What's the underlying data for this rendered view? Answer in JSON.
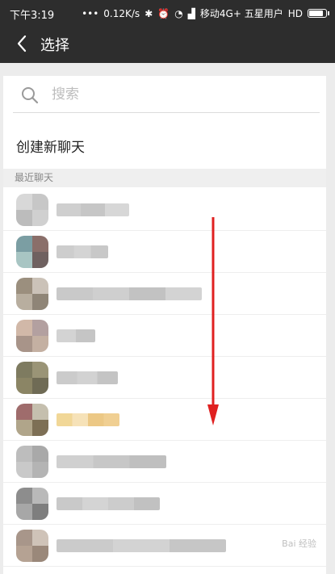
{
  "status_bar": {
    "time": "下午3:19",
    "network_speed": "0.12K/s",
    "carrier": "移动4G+ 五星用户",
    "network_type": "HD",
    "battery_level": 0.9
  },
  "app_bar": {
    "title": "选择"
  },
  "search": {
    "placeholder": "搜索",
    "value": ""
  },
  "new_chat": {
    "label": "创建新聊天"
  },
  "recent": {
    "header": "最近聊天",
    "items": [
      {
        "avatar_colors": [
          "#d8d8d8",
          "#c7c7c7",
          "#bcbcbc",
          "#d0d0d0"
        ],
        "name_colors": [
          "#cfcfcf",
          "#c6c6c6",
          "#d7d7d7"
        ],
        "name_width": 90
      },
      {
        "avatar_colors": [
          "#7b9ea3",
          "#8a6f6a",
          "#a8c5c3",
          "#6f6160"
        ],
        "name_colors": [
          "#cdcdcd",
          "#d4d4d4",
          "#c8c8c8"
        ],
        "name_width": 64
      },
      {
        "avatar_colors": [
          "#9b8f7e",
          "#cbc2b8",
          "#b8ae9f",
          "#8f8577"
        ],
        "name_colors": [
          "#c9c9c9",
          "#cfcfcf",
          "#c2c2c2",
          "#d3d3d3"
        ],
        "name_width": 180
      },
      {
        "avatar_colors": [
          "#d1b8a8",
          "#b3a0a0",
          "#a89489",
          "#c4b0a2"
        ],
        "name_colors": [
          "#d3d3d3",
          "#c5c5c5"
        ],
        "name_width": 48
      },
      {
        "avatar_colors": [
          "#7e7b60",
          "#9a9476",
          "#8b8565",
          "#6f6b55"
        ],
        "name_colors": [
          "#cbcbcb",
          "#d2d2d2",
          "#c4c4c4"
        ],
        "name_width": 76
      },
      {
        "avatar_colors": [
          "#9f6c6c",
          "#c5bfae",
          "#b0a58a",
          "#7d6f55"
        ],
        "name_colors": [
          "#f1d797",
          "#f6e2b8",
          "#ecc885",
          "#f0cf92"
        ],
        "name_width": 78
      },
      {
        "avatar_colors": [
          "#bdbdbd",
          "#a9a9a9",
          "#c9c9c9",
          "#b4b4b4"
        ],
        "name_colors": [
          "#d0d0d0",
          "#c7c7c7",
          "#bfbfbf"
        ],
        "name_width": 136
      },
      {
        "avatar_colors": [
          "#8d8d8d",
          "#b9b9b9",
          "#a7a7a7",
          "#7e7e7e"
        ],
        "name_colors": [
          "#c9c9c9",
          "#d4d4d4",
          "#cccccc",
          "#c1c1c1"
        ],
        "name_width": 128
      },
      {
        "avatar_colors": [
          "#a8968a",
          "#cfc3b8",
          "#b5a293",
          "#9a887a"
        ],
        "name_colors": [
          "#cbcbcb",
          "#d3d3d3",
          "#c6c6c6"
        ],
        "name_width": 210
      }
    ]
  },
  "watermark": {
    "text": "Bai 经验"
  },
  "colors": {
    "bar_background": "#2d2d2d",
    "arrow": "#e02020"
  }
}
